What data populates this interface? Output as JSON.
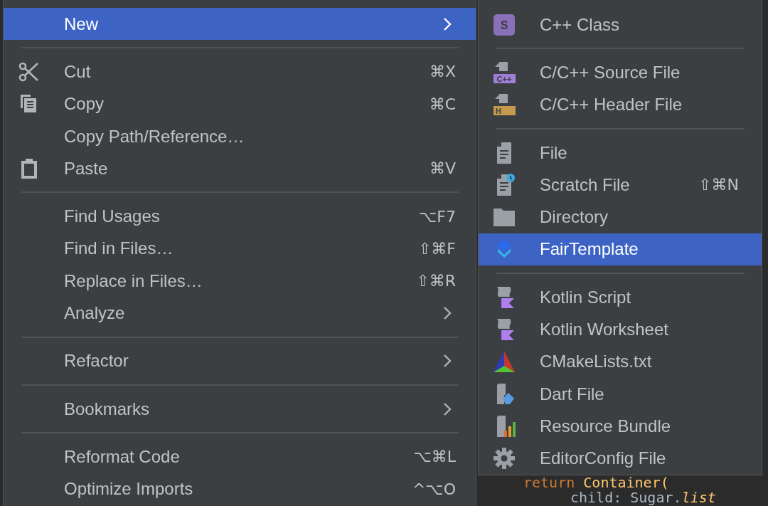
{
  "context_menu": {
    "sections": [
      [
        {
          "label": "New",
          "has_submenu": true,
          "selected": true
        }
      ],
      [
        {
          "label": "Cut",
          "shortcut": "⌘X",
          "has_submenu": false,
          "selected": false
        },
        {
          "label": "Copy",
          "shortcut": "⌘C",
          "has_submenu": false,
          "selected": false
        },
        {
          "label": "Copy Path/Reference…",
          "has_submenu": false,
          "selected": false
        },
        {
          "label": "Paste",
          "shortcut": "⌘V",
          "has_submenu": false,
          "selected": false
        }
      ],
      [
        {
          "label": "Find Usages",
          "shortcut": "⌥F7",
          "has_submenu": false,
          "selected": false
        },
        {
          "label": "Find in Files…",
          "shortcut": "⇧⌘F",
          "has_submenu": false,
          "selected": false
        },
        {
          "label": "Replace in Files…",
          "shortcut": "⇧⌘R",
          "has_submenu": false,
          "selected": false
        },
        {
          "label": "Analyze",
          "has_submenu": true,
          "selected": false
        }
      ],
      [
        {
          "label": "Refactor",
          "has_submenu": true,
          "selected": false
        }
      ],
      [
        {
          "label": "Bookmarks",
          "has_submenu": true,
          "selected": false
        }
      ],
      [
        {
          "label": "Reformat Code",
          "shortcut": "⌥⌘L",
          "has_submenu": false,
          "selected": false
        },
        {
          "label": "Optimize Imports",
          "shortcut": "^⌥O",
          "has_submenu": false,
          "selected": false
        }
      ]
    ]
  },
  "new_submenu": {
    "sections": [
      [
        {
          "label": "C++ Class",
          "icon_text": "S",
          "selected": false
        }
      ],
      [
        {
          "label": "C/C++ Source File",
          "icon_text": "C++",
          "selected": false
        },
        {
          "label": "C/C++ Header File",
          "icon_text": "H",
          "selected": false
        }
      ],
      [
        {
          "label": "File",
          "selected": false
        },
        {
          "label": "Scratch File",
          "shortcut": "⇧⌘N",
          "selected": false
        },
        {
          "label": "Directory",
          "selected": false
        },
        {
          "label": "FairTemplate",
          "selected": true
        }
      ],
      [
        {
          "label": "Kotlin Script",
          "selected": false
        },
        {
          "label": "Kotlin Worksheet",
          "selected": false
        },
        {
          "label": "CMakeLists.txt",
          "selected": false
        },
        {
          "label": "Dart File",
          "selected": false
        },
        {
          "label": "Resource Bundle",
          "selected": false
        },
        {
          "label": "EditorConfig File",
          "selected": false
        }
      ]
    ]
  },
  "editor": {
    "code_lines": [
      {
        "tokens": [
          {
            "text": "return ",
            "kind": "keyword"
          },
          {
            "text": "Container(",
            "kind": "call"
          }
        ]
      },
      {
        "tokens": [
          {
            "text": "child: Sugar.",
            "kind": "plain"
          },
          {
            "text": "list",
            "kind": "italic"
          }
        ]
      }
    ]
  }
}
